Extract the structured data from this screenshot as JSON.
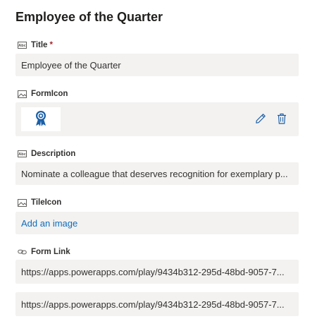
{
  "title": "Employee of the Quarter",
  "fields": {
    "title": {
      "label": "Title",
      "required_mark": "*",
      "value": "Employee of the Quarter",
      "icon": "text-field-icon"
    },
    "formicon": {
      "label": "FormIcon",
      "icon": "image-field-icon",
      "image": "award-ribbon-icon",
      "actions": [
        "edit-icon",
        "delete-icon"
      ]
    },
    "description": {
      "label": "Description",
      "value": "Nominate a colleague that deserves recognition for exemplary p...",
      "icon": "text-field-icon"
    },
    "tileicon": {
      "label": "TileIcon",
      "value": "Add an image",
      "icon": "image-field-icon"
    },
    "formlink": {
      "label": "Form Link",
      "icon": "link-icon",
      "values": [
        "https://apps.powerapps.com/play/9434b312-295d-48bd-9057-7...",
        "https://apps.powerapps.com/play/9434b312-295d-48bd-9057-7..."
      ]
    }
  },
  "colors": {
    "field_background": "#f3f2f1",
    "link": "#0f6cbd",
    "accent_blue": "#1b5fa8",
    "required": "#a4262c"
  }
}
